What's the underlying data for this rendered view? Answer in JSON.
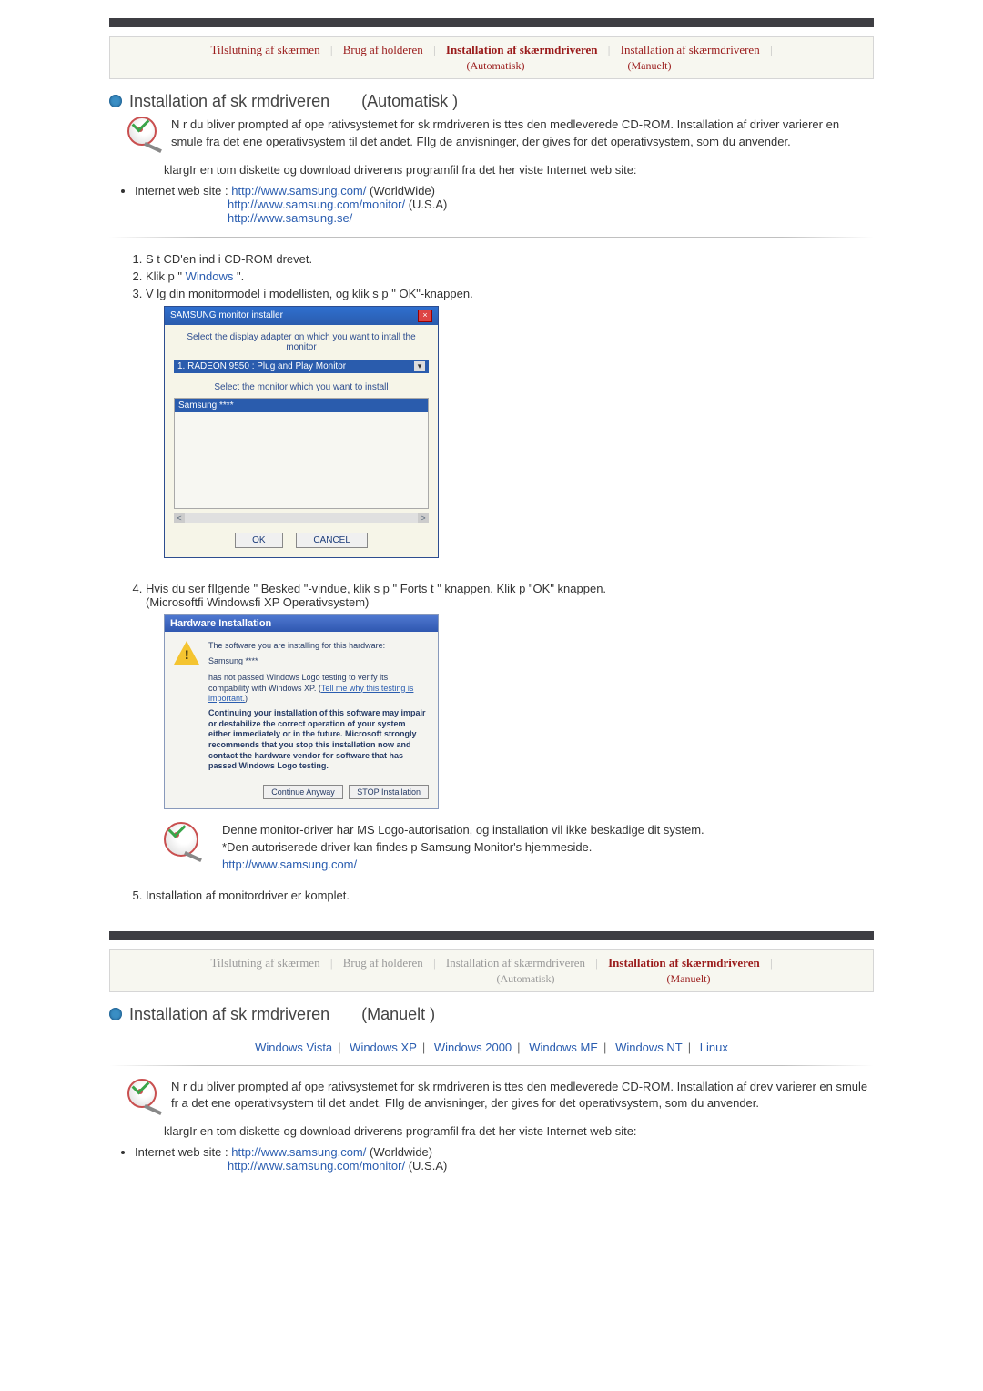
{
  "tabs_top": {
    "t1": "Tilslutning af skærmen",
    "t2": "Brug af holderen",
    "t3_line1": "Installation af skærmdriveren",
    "t3_line2": "(Automatisk)",
    "t4_line1": "Installation af skærmdriveren",
    "t4_line2": "(Manuelt)"
  },
  "section1": {
    "title_main": "Installation af sk rmdriveren",
    "title_paren": "(Automatisk  )",
    "p1": "N r du bliver prompted af ope    rativsystemet for sk rmdriveren is ttes den medleverede CD-ROM. Installation af driver varierer en smule    fra det ene operativsystem   til det andet. FIlg de anvisninger, der gives for det operativsystem, som du anvender.",
    "p2": "klargIr en tom diskette og download driverens programfil fra det her viste Internet web site:",
    "links_label": "Internet web site :",
    "link1": "http://www.samsung.com/",
    "link1_suffix": " (WorldWide)",
    "link2": "http://www.samsung.com/monitor/",
    "link2_suffix": " (U.S.A)",
    "link3": "http://www.samsung.se/"
  },
  "steps": {
    "s1": "S t CD'en ind i CD-ROM drevet.",
    "s2_pre": "Klik p  \" ",
    "s2_link": "Windows",
    "s2_post": " \".",
    "s3": "V lg din monitormodel i modellisten, og klik s  p  \"    OK\"-knappen."
  },
  "installer": {
    "title": "SAMSUNG monitor installer",
    "label1": "Select the display adapter on which you want to intall the monitor",
    "dropdown": "1. RADEON 9550 : Plug and Play Monitor",
    "label2": "Select the monitor which you want to install",
    "listitem": "Samsung ****",
    "btn_ok": "OK",
    "btn_cancel": "CANCEL"
  },
  "step4": {
    "text": "Hvis du ser fIlgende \" Besked \"-vindue, klik s  p  \"  Forts t  \" knappen. Klik p  \"OK\" knappen.",
    "sub": "(Microsoftfi Windowsfi XP Operativsystem)"
  },
  "warn": {
    "title": "Hardware Installation",
    "line1": "The software you are installing for this hardware:",
    "line2": "Samsung ****",
    "line3a": "has not passed Windows Logo testing to verify its compability with Windows XP. (",
    "line3b": "Tell me why this testing is important.",
    "line3c": ")",
    "boldtext": "Continuing your installation of this software may impair or destabilize the correct operation of your system either immediately or in the future. Microsoft strongly recommends that you stop this installation now and contact the hardware vendor for software that has passed Windows Logo testing.",
    "btn1": "Continue Anyway",
    "btn2": "STOP Installation"
  },
  "note1": {
    "line1": "Denne monitor-driver har MS Logo-autorisation, og installation vil ikke beskadige dit system.",
    "line2": "*Den autoriserede driver kan findes p  Samsung Monitor's hjemmeside.",
    "link": "http://www.samsung.com/"
  },
  "step5": "Installation af monitordriver er komplet.",
  "section2": {
    "title_main": "Installation af sk rmdriveren",
    "title_paren": "(Manuelt )"
  },
  "oslinks": {
    "a1": "Windows Vista",
    "a2": "Windows XP",
    "a3": "Windows 2000",
    "a4": "Windows ME",
    "a5": "Windows NT",
    "a6": "Linux"
  },
  "section2_body": {
    "p1": "N r du bliver prompted af ope    rativsystemet for sk rmdriveren is ttes den medleverede CD-ROM. Installation af drev varierer en smule fr    a det ene operativsystem   til det andet. FIlg de anvisninger, der gives for det operativsystem, som du anvender.",
    "p2": "klargIr en tom diskette og download driverens programfil fra det her viste Internet web site:",
    "links_label": "Internet web site :",
    "link1": "http://www.samsung.com/",
    "link1_suffix": " (Worldwide)",
    "link2": "http://www.samsung.com/monitor/",
    "link2_suffix": " (U.S.A)"
  }
}
